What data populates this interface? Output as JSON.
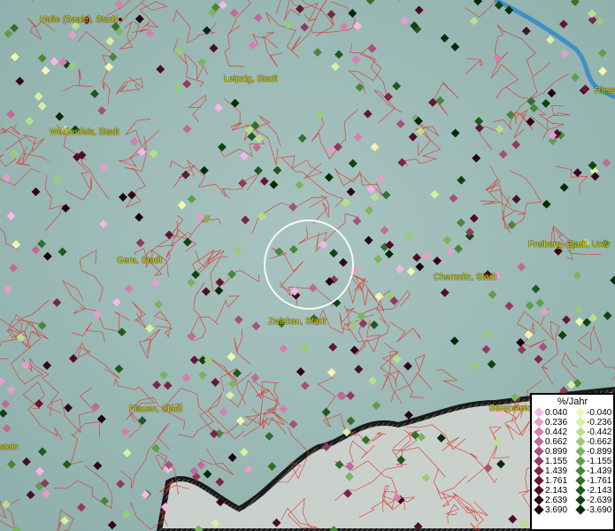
{
  "map": {
    "cities": [
      {
        "name": "Halle (Saale), Stadt"
      },
      {
        "name": "Leipzig, Stadt"
      },
      {
        "name": "Weißenfels, Stadt"
      },
      {
        "name": "Gera, Stadt"
      },
      {
        "name": "Chemnitz, Stadt"
      },
      {
        "name": "Freiberg, Stadt, Univ"
      },
      {
        "name": "Zwickau, Stadt"
      },
      {
        "name": "Plauen, Stadt"
      },
      {
        "name": "Bärenstein"
      },
      {
        "name": "Riesa"
      },
      {
        "name": "stein"
      }
    ]
  },
  "legend": {
    "title": "%/Jahr",
    "positive": [
      {
        "label": "0.040",
        "color": "#f7b6e6"
      },
      {
        "label": "0.236",
        "color": "#e79ccc"
      },
      {
        "label": "0.442",
        "color": "#d47fb0"
      },
      {
        "label": "0.662",
        "color": "#c06a98"
      },
      {
        "label": "0.899",
        "color": "#a95078"
      },
      {
        "label": "1.155",
        "color": "#913a60"
      },
      {
        "label": "1.439",
        "color": "#7a2648"
      },
      {
        "label": "1.761",
        "color": "#631735"
      },
      {
        "label": "2.143",
        "color": "#4c0d26"
      },
      {
        "label": "2.639",
        "color": "#34051a"
      },
      {
        "label": "3.690",
        "color": "#1e010f"
      }
    ],
    "negative": [
      {
        "label": "-0.040",
        "color": "#f2f7b0"
      },
      {
        "label": "-0.236",
        "color": "#d7efa6"
      },
      {
        "label": "-0.442",
        "color": "#b8e08c"
      },
      {
        "label": "-0.662",
        "color": "#98cc78"
      },
      {
        "label": "-0.899",
        "color": "#7ab460"
      },
      {
        "label": "-1.155",
        "color": "#5e9e4a"
      },
      {
        "label": "-1.439",
        "color": "#47873a"
      },
      {
        "label": "-1.761",
        "color": "#32702c"
      },
      {
        "label": "-2.143",
        "color": "#1f5a1f"
      },
      {
        "label": "-2.639",
        "color": "#0f4314"
      },
      {
        "label": "-3.690",
        "color": "#052b09"
      }
    ]
  }
}
